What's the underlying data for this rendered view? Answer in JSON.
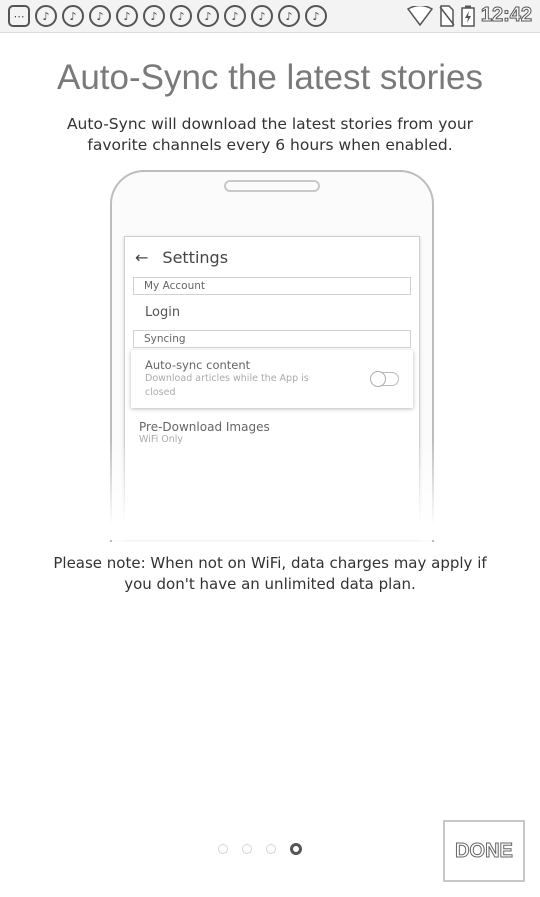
{
  "status_bar": {
    "notification_icons": [
      "more-icon",
      "music-note-icon",
      "music-note-icon",
      "music-note-icon",
      "music-note-icon",
      "music-note-icon",
      "music-note-icon",
      "music-note-icon",
      "music-note-icon",
      "music-note-icon",
      "music-note-icon",
      "music-note-icon"
    ],
    "time": "12:42"
  },
  "title": "Auto-Sync the latest stories",
  "subtitle": "Auto-Sync will download the latest stories from your favorite channels every 6 hours when enabled.",
  "phone_preview": {
    "header": "Settings",
    "section_account": "My Account",
    "login": "Login",
    "section_syncing": "Syncing",
    "autosync_title": "Auto-sync content",
    "autosync_desc": "Download articles while the App is closed",
    "predownload_title": "Pre-Download Images",
    "predownload_desc": "WiFi Only"
  },
  "note": "Please note: When not on WiFi, data charges may apply if you don't have an unlimited data plan.",
  "pager": {
    "total": 4,
    "active": 4
  },
  "done_label": "DONE"
}
